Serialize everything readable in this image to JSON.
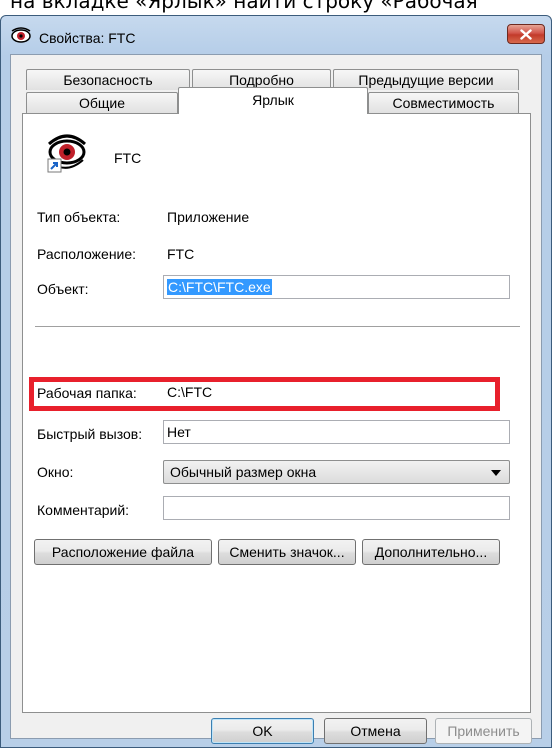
{
  "caption": "на вкладке «Ярлык» найти строку «Рабочая",
  "window": {
    "title": "Свойства: FTC"
  },
  "tabs": {
    "row_back": [
      "Безопасность",
      "Подробно",
      "Предыдущие версии"
    ],
    "row_front": [
      "Общие",
      "Ярлык",
      "Совместимость"
    ],
    "active": "Ярлык"
  },
  "shortcut": {
    "name": "FTC"
  },
  "fields": {
    "type_label": "Тип объекта:",
    "type_value": "Приложение",
    "location_label": "Расположение:",
    "location_value": "FTC",
    "object_label": "Объект:",
    "object_value": "C:\\FTC\\FTC.exe",
    "workdir_label": "Рабочая папка:",
    "workdir_value": "C:\\FTC",
    "hotkey_label": "Быстрый вызов:",
    "hotkey_value": "Нет",
    "window_label": "Окно:",
    "window_value": "Обычный размер окна",
    "comment_label": "Комментарий:",
    "comment_value": ""
  },
  "buttons": {
    "file_location": "Расположение файла",
    "change_icon": "Сменить значок...",
    "advanced": "Дополнительно...",
    "ok": "OK",
    "cancel": "Отмена",
    "apply": "Применить"
  },
  "colors": {
    "highlight": "#e8202c",
    "selection": "#3399ff"
  }
}
